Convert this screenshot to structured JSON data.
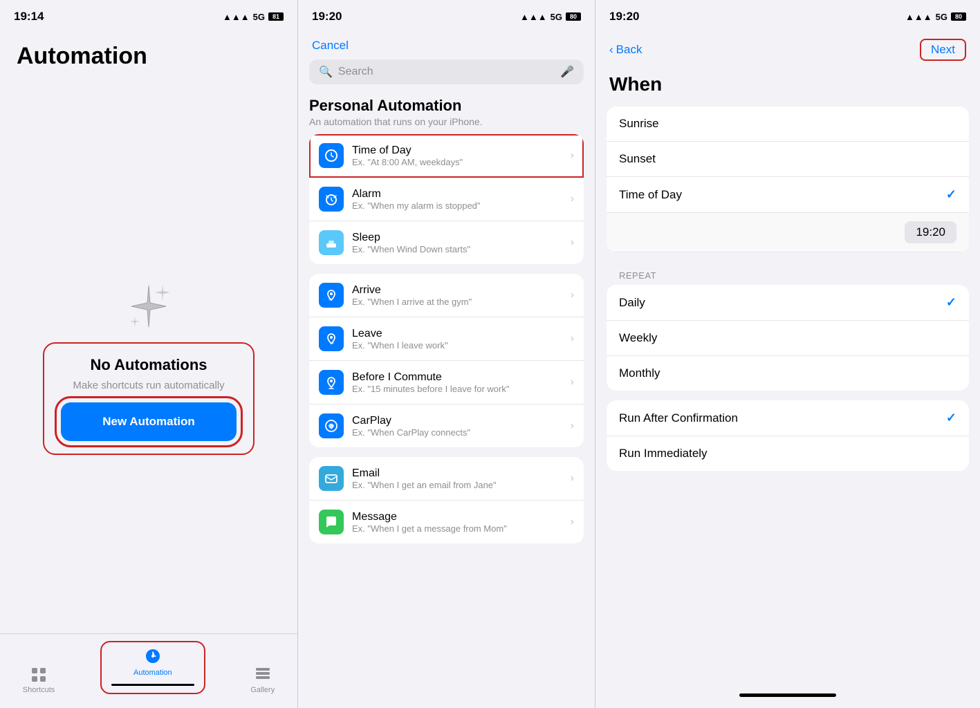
{
  "screen1": {
    "status_time": "19:14",
    "signal": "5G",
    "battery": "81",
    "title": "Automation",
    "sparkle_label": "sparkle",
    "no_automations": "No Automations",
    "no_automations_sub": "Make shortcuts run automatically",
    "new_automation_btn": "New Automation",
    "tab_shortcuts": "Shortcuts",
    "tab_automation": "Automation",
    "tab_gallery": "Gallery"
  },
  "screen2": {
    "status_time": "19:20",
    "signal": "5G",
    "battery": "80",
    "cancel_label": "Cancel",
    "search_placeholder": "Search",
    "section_title": "Personal Automation",
    "section_sub": "An automation that runs on your iPhone.",
    "items_group1": [
      {
        "title": "Time of Day",
        "sub": "Ex. \"At 8:00 AM, weekdays\"",
        "icon_color": "#007aff",
        "icon_type": "clock",
        "highlighted": true
      },
      {
        "title": "Alarm",
        "sub": "Ex. \"When my alarm is stopped\"",
        "icon_color": "#007aff",
        "icon_type": "alarm",
        "highlighted": false
      },
      {
        "title": "Sleep",
        "sub": "Ex. \"When Wind Down starts\"",
        "icon_color": "#5ac8fa",
        "icon_type": "sleep",
        "highlighted": false
      }
    ],
    "items_group2": [
      {
        "title": "Arrive",
        "sub": "Ex. \"When I arrive at the gym\"",
        "icon_color": "#007aff",
        "icon_type": "location",
        "highlighted": false
      },
      {
        "title": "Leave",
        "sub": "Ex. \"When I leave work\"",
        "icon_color": "#007aff",
        "icon_type": "location-leave",
        "highlighted": false
      },
      {
        "title": "Before I Commute",
        "sub": "Ex. \"15 minutes before I leave for work\"",
        "icon_color": "#007aff",
        "icon_type": "commute",
        "highlighted": false
      },
      {
        "title": "CarPlay",
        "sub": "Ex. \"When CarPlay connects\"",
        "icon_color": "#007aff",
        "icon_type": "carplay",
        "highlighted": false
      }
    ],
    "items_group3": [
      {
        "title": "Email",
        "sub": "Ex. \"When I get an email from Jane\"",
        "icon_color": "#34aadc",
        "icon_type": "email",
        "highlighted": false
      },
      {
        "title": "Message",
        "sub": "Ex. \"When I get a message from Mom\"",
        "icon_color": "#34c759",
        "icon_type": "message",
        "highlighted": false
      }
    ]
  },
  "screen3": {
    "status_time": "19:20",
    "signal": "5G",
    "battery": "80",
    "back_label": "Back",
    "next_label": "Next",
    "title": "When",
    "when_items": [
      {
        "label": "Sunrise",
        "checked": false
      },
      {
        "label": "Sunset",
        "checked": false
      },
      {
        "label": "Time of Day",
        "checked": true
      }
    ],
    "time_value": "19:20",
    "repeat_label": "REPEAT",
    "repeat_items": [
      {
        "label": "Daily",
        "checked": true
      },
      {
        "label": "Weekly",
        "checked": false
      },
      {
        "label": "Monthly",
        "checked": false
      }
    ],
    "run_items": [
      {
        "label": "Run After Confirmation",
        "checked": true
      },
      {
        "label": "Run Immediately",
        "checked": false
      }
    ]
  }
}
